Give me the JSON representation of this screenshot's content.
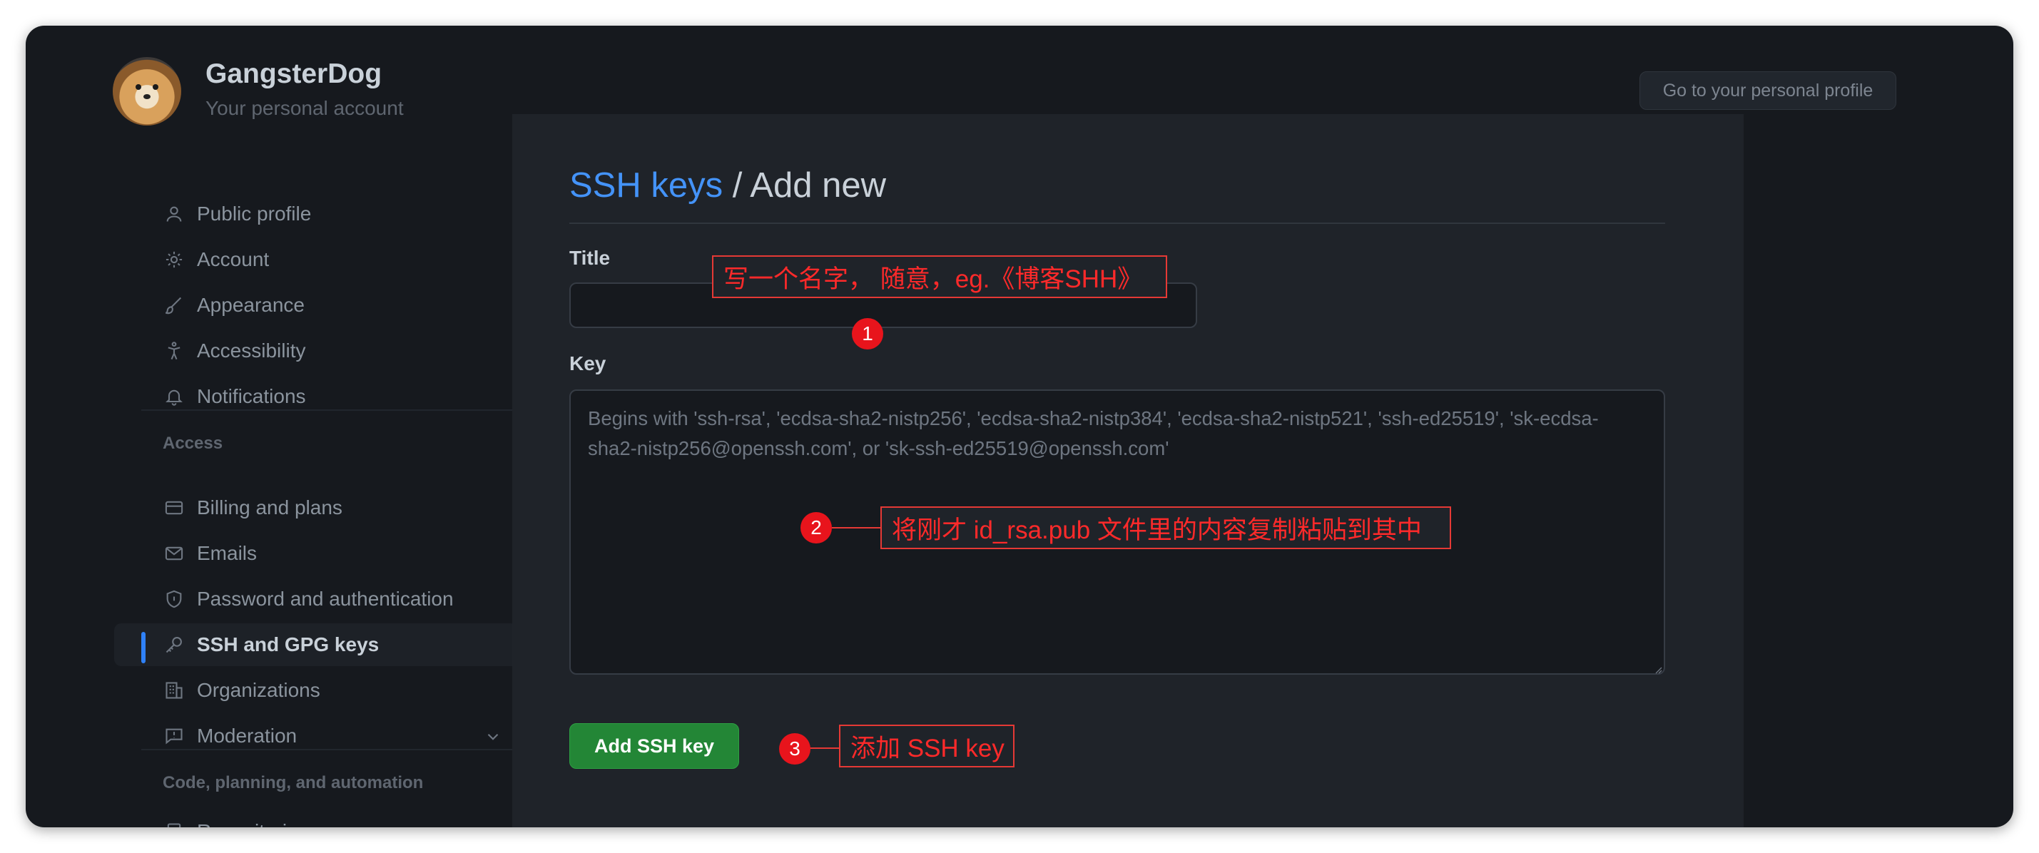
{
  "account": {
    "username": "GangsterDog",
    "subtitle": "Your personal account",
    "profile_button": "Go to your personal profile"
  },
  "sidebar": {
    "items": [
      {
        "label": "Public profile",
        "icon": "person-icon"
      },
      {
        "label": "Account",
        "icon": "gear-icon"
      },
      {
        "label": "Appearance",
        "icon": "paintbrush-icon"
      },
      {
        "label": "Accessibility",
        "icon": "accessibility-icon"
      },
      {
        "label": "Notifications",
        "icon": "bell-icon"
      }
    ],
    "access_heading": "Access",
    "access_items": [
      {
        "label": "Billing and plans",
        "icon": "credit-card-icon"
      },
      {
        "label": "Emails",
        "icon": "mail-icon"
      },
      {
        "label": "Password and authentication",
        "icon": "shield-icon"
      },
      {
        "label": "SSH and GPG keys",
        "icon": "key-icon",
        "active": true
      },
      {
        "label": "Organizations",
        "icon": "organization-icon"
      },
      {
        "label": "Moderation",
        "icon": "report-icon"
      }
    ],
    "code_heading": "Code, planning, and automation",
    "code_items": [
      {
        "label": "Repositories",
        "icon": "repo-icon"
      }
    ]
  },
  "main": {
    "breadcrumb_link": "SSH keys",
    "breadcrumb_sep": " / ",
    "breadcrumb_current": "Add new",
    "title_label": "Title",
    "title_value": "",
    "key_label": "Key",
    "key_placeholder": "Begins with 'ssh-rsa', 'ecdsa-sha2-nistp256', 'ecdsa-sha2-nistp384', 'ecdsa-sha2-nistp521', 'ssh-ed25519', 'sk-ecdsa-sha2-nistp256@openssh.com', or 'sk-ssh-ed25519@openssh.com'",
    "submit_label": "Add SSH key"
  },
  "annotations": [
    {
      "number": "1",
      "text": "写一个名字， 随意，eg.《博客SHH》"
    },
    {
      "number": "2",
      "text": "将刚才 id_rsa.pub 文件里的内容复制粘贴到其中"
    },
    {
      "number": "3",
      "text": "添加 SSH key"
    }
  ],
  "colors": {
    "background": "#16191e",
    "panel": "#1f2329",
    "accent_link": "#4493f8",
    "primary_button": "#238636",
    "annotation_red": "#e53935"
  }
}
